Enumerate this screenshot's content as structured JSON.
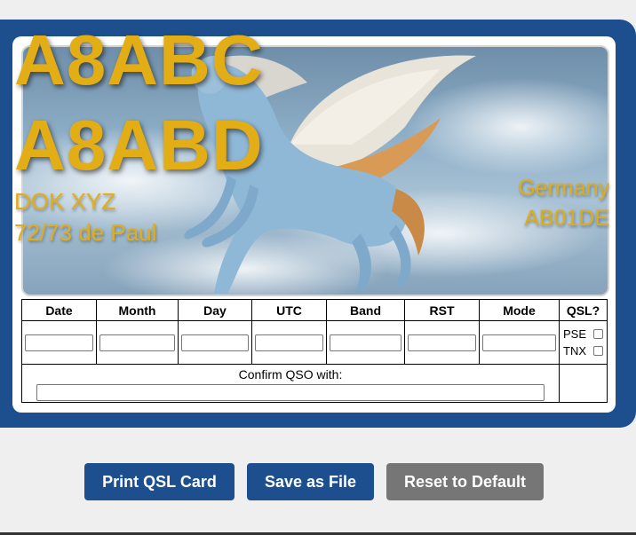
{
  "card": {
    "callsign_1": "A8ABC",
    "callsign_2": "A8ABD",
    "dok": "DOK XYZ",
    "greeting": "72/73 de Paul",
    "country": "Germany",
    "locator": "AB01DE",
    "image_subject": "winged-horse"
  },
  "qso_table": {
    "headers": [
      "Date",
      "Month",
      "Day",
      "UTC",
      "Band",
      "RST",
      "Mode",
      "QSL?"
    ],
    "values": [
      "",
      "",
      "",
      "",
      "",
      "",
      ""
    ],
    "qsl_options": [
      {
        "label": "PSE",
        "checked": false
      },
      {
        "label": "TNX",
        "checked": false
      }
    ],
    "confirm_label": "Confirm QSO with:",
    "confirm_value": ""
  },
  "buttons": {
    "print": "Print QSL Card",
    "save": "Save as File",
    "reset": "Reset to Default"
  },
  "colors": {
    "frame": "#1d4f8f",
    "callsign_text": "#e3ae15",
    "primary_button": "#1d4f8f",
    "secondary_button": "#767676"
  }
}
